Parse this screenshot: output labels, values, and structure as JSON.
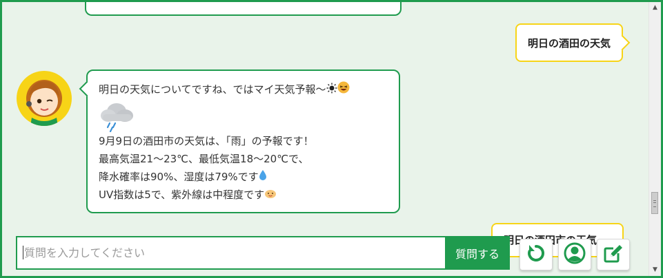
{
  "conversation": {
    "user_message_1": "明日の酒田の天気",
    "bot_reply": {
      "intro": "明日の天気についてですね、ではマイ天気予報〜",
      "detail_lines": [
        "9月9日の酒田市の天気は、「雨」の予報です！",
        "最高気温21〜23℃、最低気温18〜20℃で、",
        "降水確率は90%、湿度は79%です",
        "UV指数は5で、紫外線は中程度です"
      ]
    },
    "user_message_2": "明日の酒田市の天気"
  },
  "input": {
    "placeholder": "質問を入力してください",
    "value": ""
  },
  "buttons": {
    "submit_label": "質問する"
  },
  "icons": {
    "avatar": "operator-avatar",
    "sun": "sun-icon",
    "laughing": "laughing-face-emoji",
    "rain_cloud": "rain-cloud-icon",
    "droplet": "droplet-icon",
    "sun_face": "sun-face-emoji",
    "reset": "reset-icon",
    "profile": "profile-icon",
    "edit": "edit-icon"
  },
  "colors": {
    "accent": "#1f9b4e",
    "user_bubble_border": "#f7d417",
    "background": "#e9f3ea"
  }
}
